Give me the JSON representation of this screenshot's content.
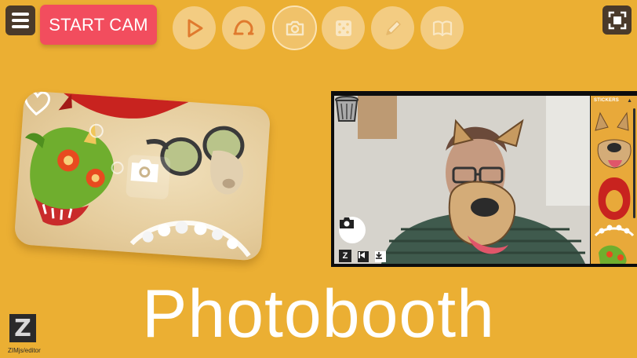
{
  "toolbar": {
    "start_label": "START CAM",
    "tools": [
      {
        "name": "play",
        "icon": "play-icon"
      },
      {
        "name": "sticker-loop",
        "icon": "loop-icon"
      },
      {
        "name": "camera",
        "icon": "camera-icon",
        "active": true
      },
      {
        "name": "dice",
        "icon": "dice-icon"
      },
      {
        "name": "edit",
        "icon": "pencil-icon"
      },
      {
        "name": "book",
        "icon": "book-icon"
      }
    ]
  },
  "preview": {
    "stickers_label": "STICKERS",
    "stickers_arrow": "▲",
    "logo_letter": "Z"
  },
  "title": "Photobooth",
  "zim": {
    "logo_letter": "Z",
    "caption": "ZIMjs/editor"
  },
  "colors": {
    "background": "#ebaf33",
    "start_button": "#f24d5e",
    "tool_button": "#f3cc82",
    "icon_accent": "#e07a2e",
    "dark_button": "#4a3a2a"
  }
}
